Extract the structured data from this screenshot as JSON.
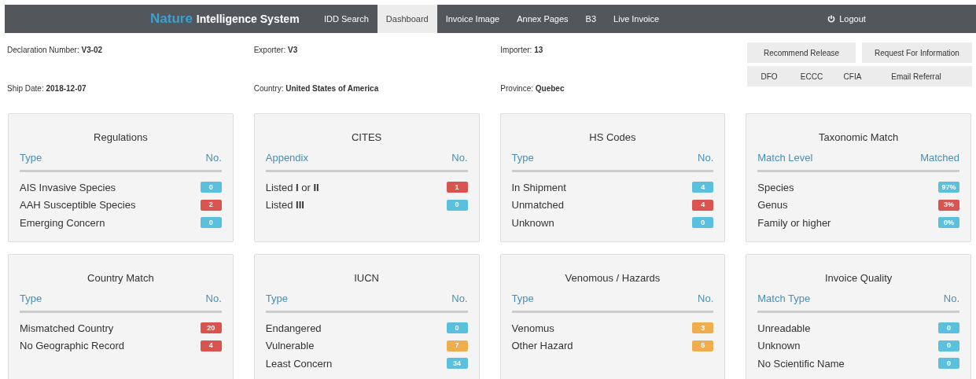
{
  "navbar": {
    "brand_highlight": "Nature",
    "brand_rest": "Intelligence System",
    "tabs": [
      {
        "label": "IDD Search",
        "selected": false
      },
      {
        "label": "Dashboard",
        "selected": true
      },
      {
        "label": "Invoice Image",
        "selected": false
      },
      {
        "label": "Annex Pages",
        "selected": false
      },
      {
        "label": "B3",
        "selected": false
      },
      {
        "label": "Live Invoice",
        "selected": false
      }
    ],
    "logout": "Logout"
  },
  "declaration": {
    "fields": [
      {
        "label": "Declaration Number:",
        "value": "V3-02"
      },
      {
        "label": "Ship Date:",
        "value": "2018-12-07"
      },
      {
        "label": "Exporter:",
        "value": "V3"
      },
      {
        "label": "Country:",
        "value": "United States of America"
      },
      {
        "label": "Importer:",
        "value": "13"
      },
      {
        "label": "Province:",
        "value": "Quebec"
      }
    ]
  },
  "actions": {
    "primary": [
      "Recommend Release",
      "Request For Information"
    ],
    "referrals": [
      "DFO",
      "ECCC",
      "CFIA",
      "Email Referral"
    ]
  },
  "panels": [
    {
      "title": "Regulations",
      "columns": [
        "Type",
        "No."
      ],
      "rows": [
        {
          "label": "AIS Invasive Species",
          "value": "0",
          "color": "#5bc0de"
        },
        {
          "label": "AAH Susceptible Species",
          "value": "2",
          "color": "#d9534f"
        },
        {
          "label": "Emerging Concern",
          "value": "0",
          "color": "#5bc0de"
        }
      ]
    },
    {
      "title": "CITES",
      "columns": [
        "Appendix",
        "No."
      ],
      "rows": [
        {
          "label": "Listed **I** or **II**",
          "value": "1",
          "color": "#d9534f"
        },
        {
          "label": "Listed **III**",
          "value": "0",
          "color": "#5bc0de"
        }
      ]
    },
    {
      "title": "HS Codes",
      "columns": [
        "Type",
        "No."
      ],
      "rows": [
        {
          "label": "In Shipment",
          "value": "4",
          "color": "#5bc0de"
        },
        {
          "label": "Unmatched",
          "value": "4",
          "color": "#d9534f"
        },
        {
          "label": "Unknown",
          "value": "0",
          "color": "#5bc0de"
        }
      ]
    },
    {
      "title": "Taxonomic Match",
      "columns": [
        "Match Level",
        "Matched"
      ],
      "rows": [
        {
          "label": "Species",
          "value": "97%",
          "color": "#5bc0de"
        },
        {
          "label": "Genus",
          "value": "3%",
          "color": "#d9534f"
        },
        {
          "label": "Family or higher",
          "value": "0%",
          "color": "#5bc0de"
        }
      ]
    },
    {
      "title": "Country Match",
      "columns": [
        "Type",
        "No."
      ],
      "rows": [
        {
          "label": "Mismatched Country",
          "value": "20",
          "color": "#d9534f"
        },
        {
          "label": "No Geographic Record",
          "value": "4",
          "color": "#d9534f"
        }
      ]
    },
    {
      "title": "IUCN",
      "columns": [
        "Type",
        "No."
      ],
      "rows": [
        {
          "label": "Endangered",
          "value": "0",
          "color": "#5bc0de"
        },
        {
          "label": "Vulnerable",
          "value": "7",
          "color": "#f0ad4e"
        },
        {
          "label": "Least Concern",
          "value": "34",
          "color": "#5bc0de"
        }
      ]
    },
    {
      "title": "Venomous / Hazards",
      "columns": [
        "Type",
        "No."
      ],
      "rows": [
        {
          "label": "Venomus",
          "value": "3",
          "color": "#f0ad4e"
        },
        {
          "label": "Other Hazard",
          "value": "5",
          "color": "#f0ad4e"
        }
      ]
    },
    {
      "title": "Invoice Quality",
      "columns": [
        "Match Type",
        "No."
      ],
      "rows": [
        {
          "label": "Unreadable",
          "value": "0",
          "color": "#5bc0de"
        },
        {
          "label": "Unknown",
          "value": "0",
          "color": "#5bc0de"
        },
        {
          "label": "No Scientific Name",
          "value": "0",
          "color": "#5bc0de"
        }
      ]
    }
  ]
}
